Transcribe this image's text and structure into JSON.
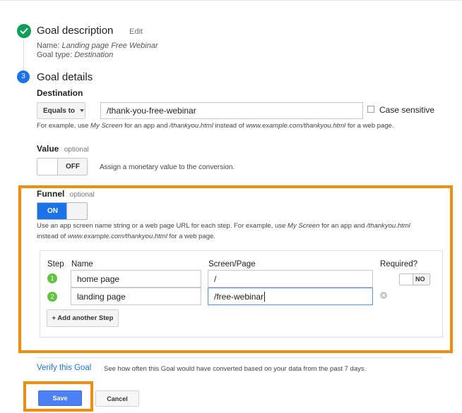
{
  "goal_description": {
    "title": "Goal description",
    "edit_label": "Edit",
    "name_prefix": "Name: ",
    "name_value": "Landing page Free Webinar",
    "type_prefix": "Goal type: ",
    "type_value": "Destination"
  },
  "goal_details": {
    "step_number": "3",
    "title": "Goal details"
  },
  "destination": {
    "label": "Destination",
    "match_type": "Equals to",
    "value": "/thank-you-free-webinar",
    "case_sensitive_label": "Case sensitive",
    "help": {
      "p1": "For example, use ",
      "e1": "My Screen",
      "p2": " for an app and ",
      "e2": "/thankyou.html",
      "p3": " instead of ",
      "e3": "www.example.com/thankyou.html",
      "p4": " for a web page."
    }
  },
  "value_section": {
    "label": "Value",
    "optional": "optional",
    "toggle_state": "OFF",
    "description": "Assign a monetary value to the conversion."
  },
  "funnel": {
    "label": "Funnel",
    "optional": "optional",
    "toggle_state": "ON",
    "help": {
      "p1": "Use an app screen name string or a web page URL for each step. For example, use ",
      "e1": "My Screen",
      "p2": " for an app and ",
      "e2": "/thankyou.html",
      "p3": "instead of ",
      "e3": "www.example.com/thankyou.html",
      "p4": " for a web page."
    },
    "columns": {
      "step": "Step",
      "name": "Name",
      "screen": "Screen/Page",
      "required": "Required?"
    },
    "required_toggle": "NO",
    "steps": [
      {
        "number": "1",
        "name": "home page",
        "screen": "/"
      },
      {
        "number": "2",
        "name": "landing page",
        "screen": "/free-webinar"
      }
    ],
    "add_step_label": "+ Add another Step"
  },
  "verify": {
    "link": "Verify this Goal",
    "description": "See how often this Goal would have converted based on your data from the past 7 days."
  },
  "actions": {
    "save": "Save",
    "cancel": "Cancel"
  },
  "colors": {
    "highlight": "#f28c0f",
    "primary": "#1a73e8",
    "success": "#0f9d58",
    "step_green": "#61c23e"
  }
}
